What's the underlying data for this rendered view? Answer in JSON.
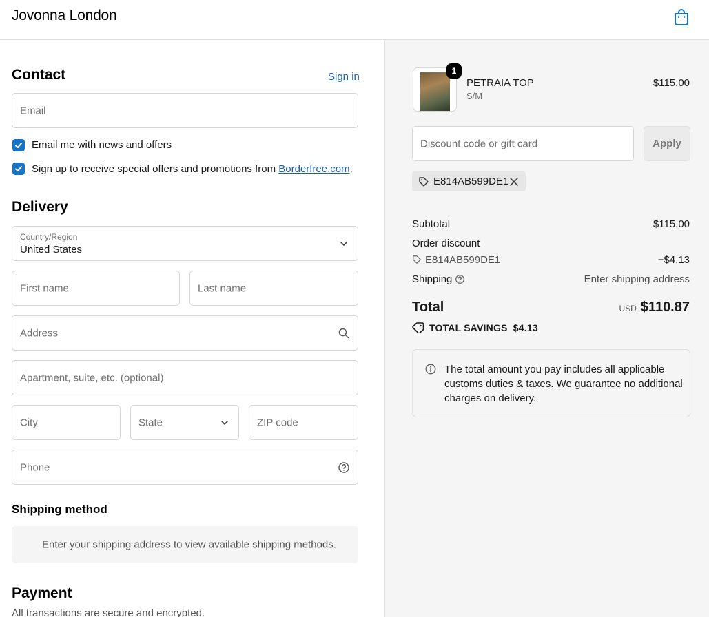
{
  "header": {
    "brand": "Jovonna London",
    "cart_icon": "shopping-bag-icon"
  },
  "contact": {
    "title": "Contact",
    "sign_in": "Sign in",
    "email_placeholder": "Email",
    "checkbox_news": "Email me with news and offers",
    "checkbox_borderfree_prefix": "Sign up to receive special offers and promotions from ",
    "checkbox_borderfree_link": "Borderfree.com",
    "checkbox_borderfree_suffix": "."
  },
  "delivery": {
    "title": "Delivery",
    "country_label": "Country/Region",
    "country_value": "United States",
    "first_name": "First name",
    "last_name": "Last name",
    "address": "Address",
    "apartment": "Apartment, suite, etc. (optional)",
    "city": "City",
    "state": "State",
    "zip": "ZIP code",
    "phone": "Phone"
  },
  "shipping_method": {
    "title": "Shipping method",
    "info": "Enter your shipping address to view available shipping methods."
  },
  "payment": {
    "title": "Payment",
    "subtitle": "All transactions are secure and encrypted."
  },
  "summary": {
    "item": {
      "name": "PETRAIA TOP",
      "variant": "S/M",
      "price": "$115.00",
      "quantity": "1"
    },
    "discount_placeholder": "Discount code or gift card",
    "apply": "Apply",
    "applied_code": "E814AB599DE1",
    "subtotal_label": "Subtotal",
    "subtotal_value": "$115.00",
    "order_discount_label": "Order discount",
    "order_discount_code": "E814AB599DE1",
    "order_discount_value": "−$4.13",
    "shipping_label": "Shipping",
    "shipping_value": "Enter shipping address",
    "total_label": "Total",
    "total_currency": "USD",
    "total_value": "$110.87",
    "savings_label": "TOTAL SAVINGS",
    "savings_value": "$4.13",
    "notice": "The total amount you pay includes all applicable customs duties & taxes. We guarantee no additional charges on delivery."
  },
  "colors": {
    "accent": "#1773c4",
    "link": "#1f5ea8",
    "summary_bg": "#f5f5f5"
  }
}
